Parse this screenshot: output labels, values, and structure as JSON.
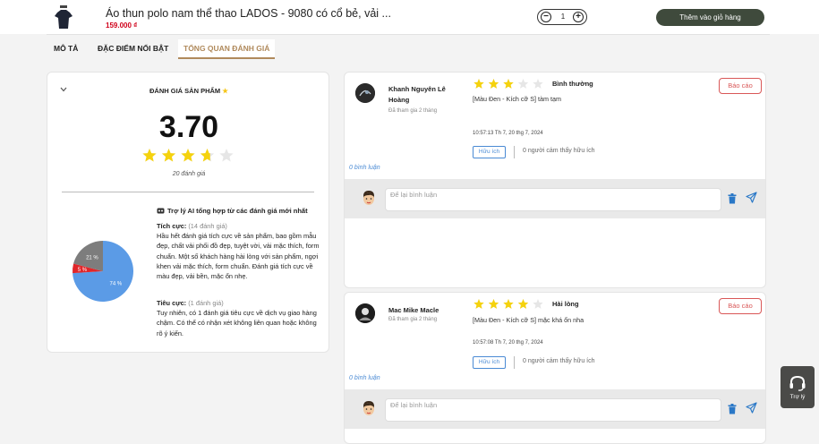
{
  "product": {
    "title": "Áo thun polo nam thể thao LADOS - 9080 có cổ bẻ, vải ...",
    "price": "159.000 ₫",
    "quantity": "1",
    "add_to_cart": "Thêm vào giỏ hàng"
  },
  "tabs": [
    {
      "label": "MÔ TẢ"
    },
    {
      "label": "ĐẶC ĐIỂM NỔI BẬT"
    },
    {
      "label": "TỔNG QUAN ĐÁNH GIÁ",
      "active": true
    }
  ],
  "summary": {
    "title": "ĐÁNH GIÁ SẢN PHẨM",
    "title_icon": "star-icon",
    "score": "3.70",
    "stars_value": 3.7,
    "stars_max": 5,
    "count": "20 đánh giá",
    "ai_heading": "Trợ lý AI tổng hợp từ các đánh giá mới nhất",
    "positive_label": "Tích cực:",
    "positive_count": "(14 đánh giá)",
    "positive_text": "Hầu hết đánh giá tích cực về sản phẩm, bao gồm mẫu đẹp, chất vải phối đồ đẹp, tuyệt vời, vải mặc thích, form chuẩn. Một số khách hàng hài lòng với sản phẩm, ngợi khen vải mặc thích, form chuẩn. Đánh giá tích cực về màu đẹp, vải bền, mặc ổn nhẹ.",
    "negative_label": "Tiêu cực:",
    "negative_count": "(1 đánh giá)",
    "negative_text": "Tuy nhiên, có 1 đánh giá tiêu cực về dịch vụ giao hàng chậm. Có thể có nhận xét không liên quan hoặc không rõ ý kiến."
  },
  "chart_data": {
    "type": "pie",
    "slices": [
      {
        "label": "74 %",
        "value": 74,
        "color": "#5b9be6"
      },
      {
        "label": "5 %",
        "value": 5,
        "color": "#e0262a"
      },
      {
        "label": "21 %",
        "value": 21,
        "color": "#7d7d7d"
      }
    ]
  },
  "reviews": [
    {
      "name": "Khanh Nguyên Lê Hoàng",
      "joined": "Đã tham gia 2 tháng",
      "stars": 3,
      "rating_label": "Bình thường",
      "text": "[Màu Đen - Kích cỡ S] tàm tạm",
      "time": "10:57:13 Th 7, 20 thg 7, 2024",
      "useful_label": "Hữu ích",
      "useful_count": "0 người cảm thấy hữu ích",
      "report_label": "Báo cáo",
      "comment_count": "0 bình luận",
      "comment_placeholder": "Để lại bình luận"
    },
    {
      "name": "Mac Mike Macle",
      "joined": "Đã tham gia 2 tháng",
      "stars": 4,
      "rating_label": "Hài lòng",
      "text": "[Màu Đen - Kích cỡ S] mặc khá ổn nha",
      "time": "10:57:08 Th 7, 20 thg 7, 2024",
      "useful_label": "Hữu ích",
      "useful_count": "0 người cảm thấy hữu ích",
      "report_label": "Báo cáo",
      "comment_count": "0 bình luận",
      "comment_placeholder": "Để lại bình luận"
    }
  ],
  "support": {
    "label": "Trợ lý"
  },
  "colors": {
    "accent": "#b08a5c",
    "star": "#f5d20d",
    "star_empty": "#e6e6e6",
    "report": "#d95757",
    "link": "#4a8ad4"
  }
}
